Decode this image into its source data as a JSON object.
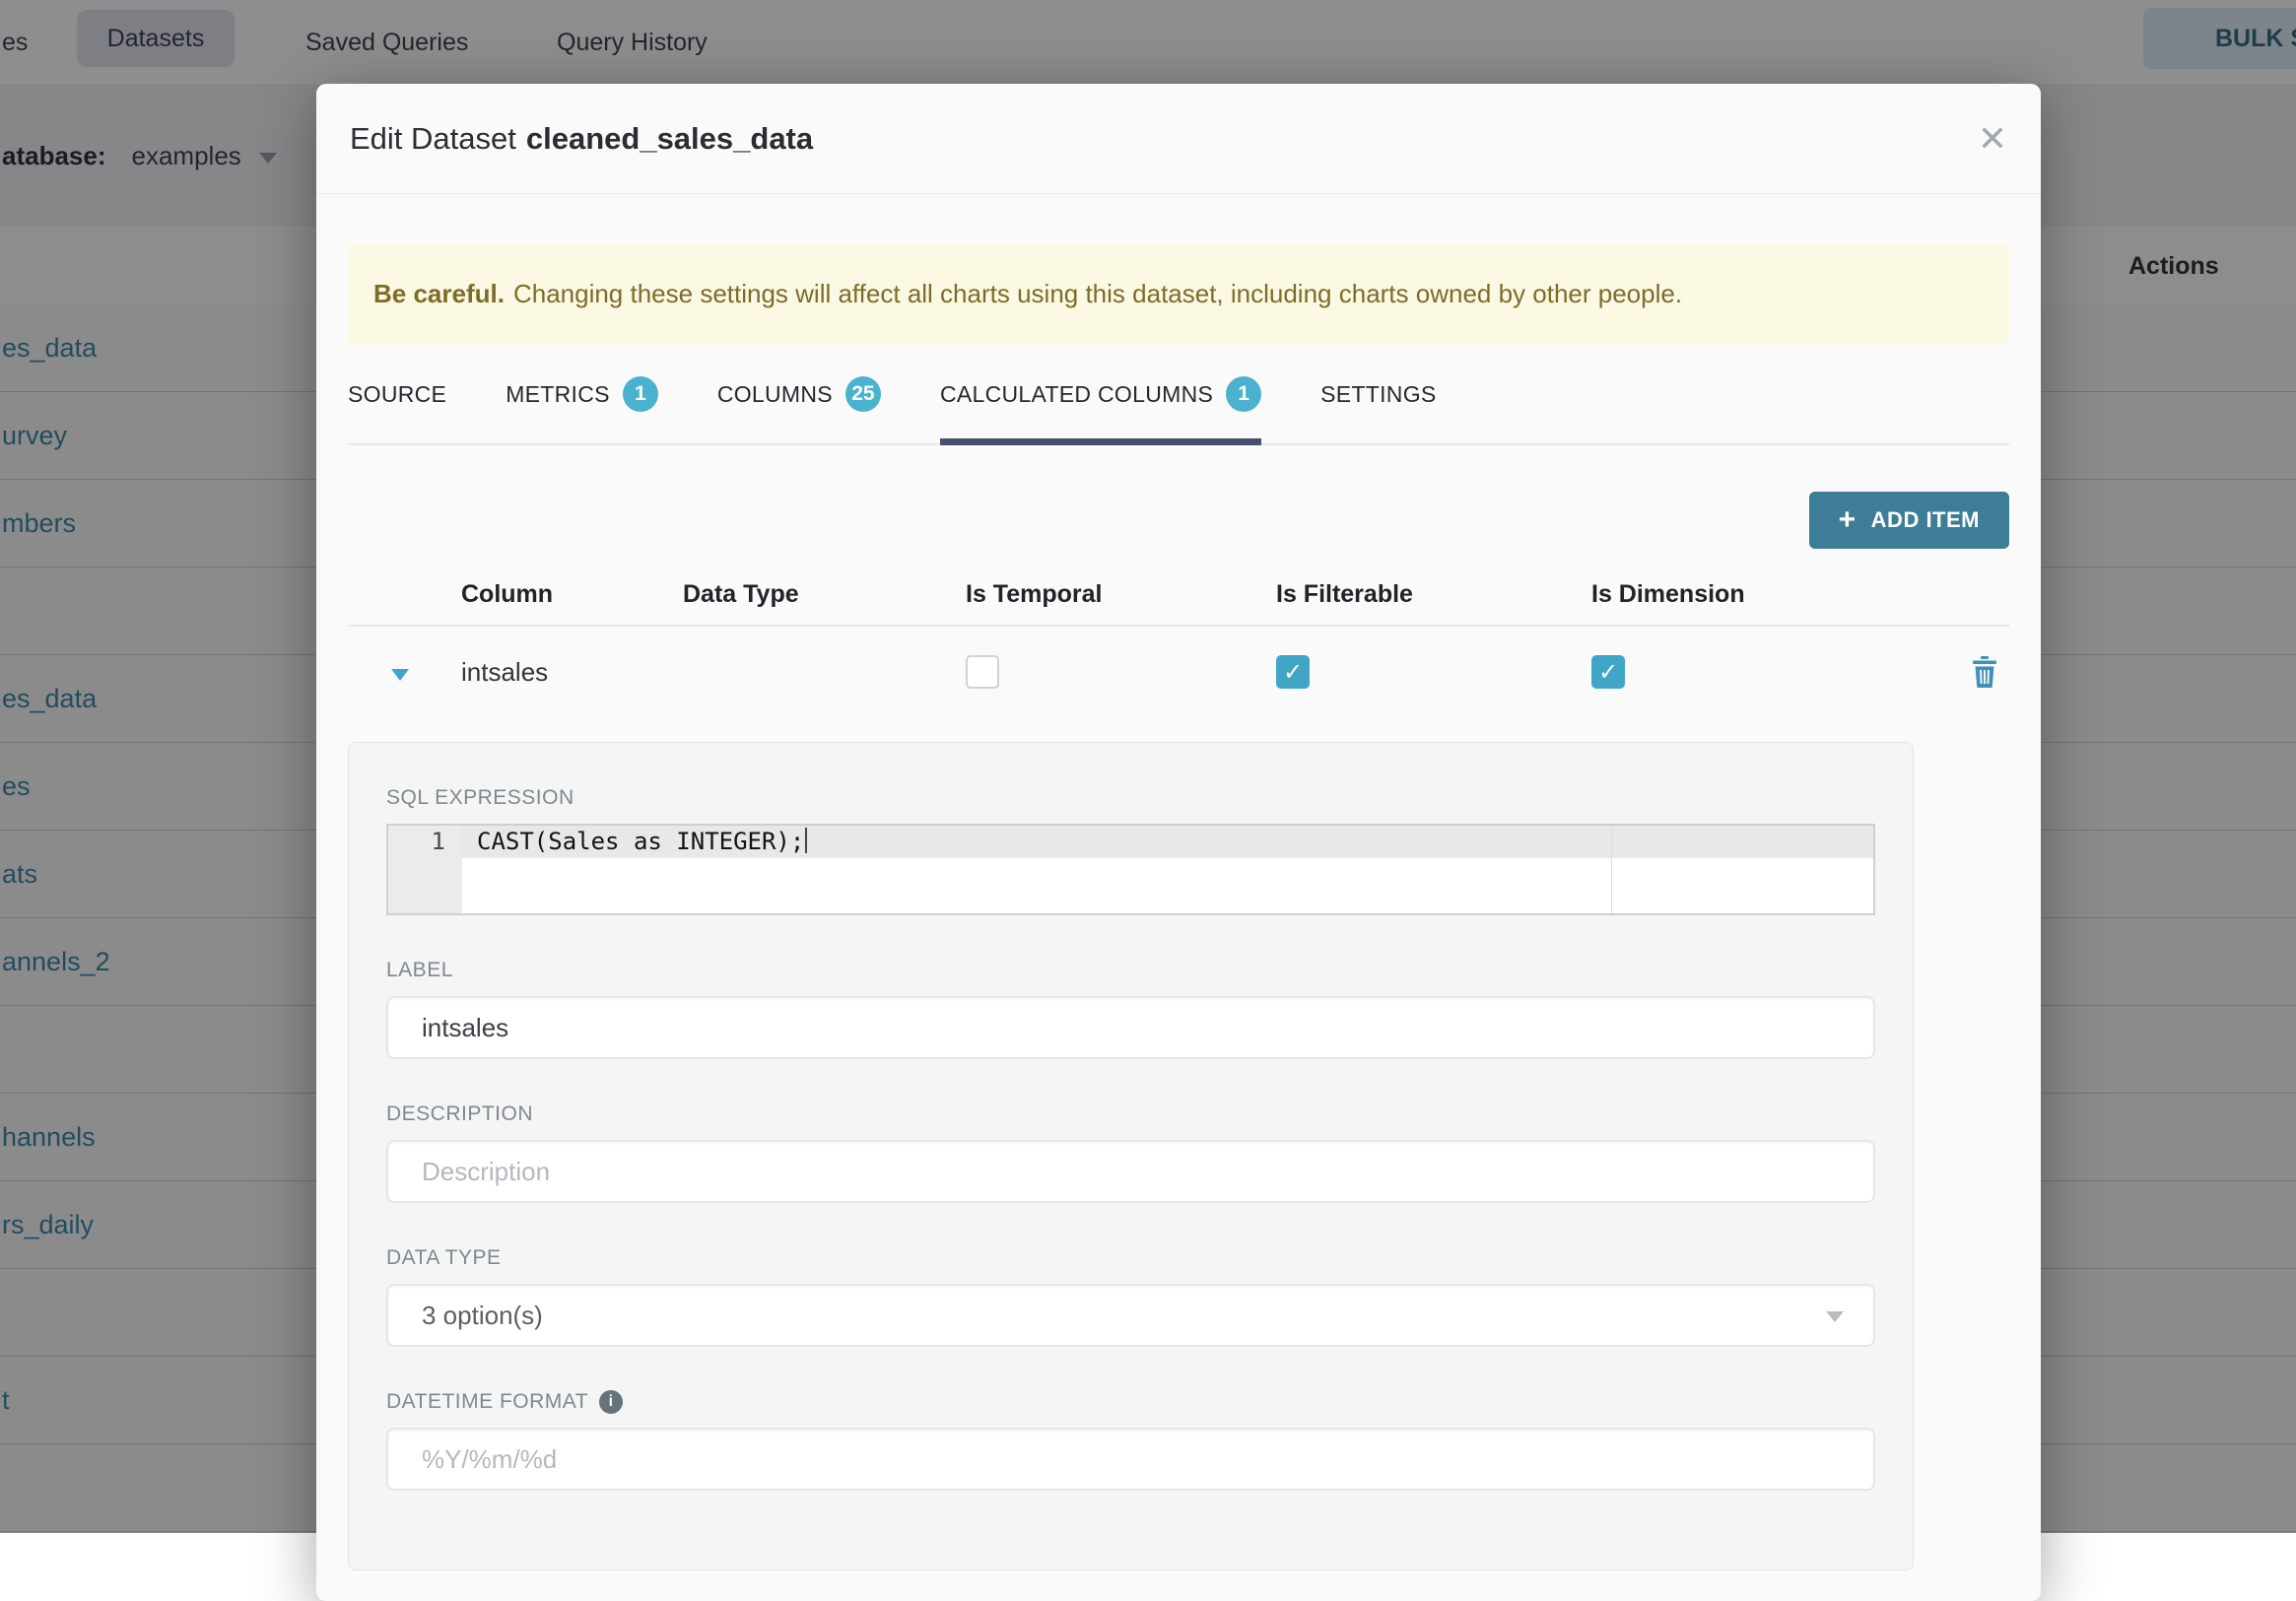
{
  "background": {
    "nav": {
      "tab_fragment": "es",
      "tabs": [
        "Datasets",
        "Saved Queries",
        "Query History"
      ],
      "bulk_select_label": "BULK SELE"
    },
    "filter": {
      "database_label": "atabase:",
      "database_value": "examples"
    },
    "table": {
      "actions_header": "Actions",
      "rows": [
        {
          "label": "es_data"
        },
        {
          "label": "urvey"
        },
        {
          "label": "mbers"
        },
        {
          "label": ""
        },
        {
          "label": "es_data"
        },
        {
          "label": "es"
        },
        {
          "label": "ats"
        },
        {
          "label": "annels_2"
        },
        {
          "label": ""
        },
        {
          "label": "hannels"
        },
        {
          "label": "rs_daily"
        },
        {
          "label": ""
        },
        {
          "label": "t"
        },
        {
          "label": ""
        }
      ]
    }
  },
  "modal": {
    "title_prefix": "Edit Dataset",
    "title_name": "cleaned_sales_data",
    "warning": {
      "bold": "Be careful.",
      "text": "Changing these settings will affect all charts using this dataset, including charts owned by other people."
    },
    "tabs": [
      {
        "label": "SOURCE"
      },
      {
        "label": "METRICS",
        "badge": "1"
      },
      {
        "label": "COLUMNS",
        "badge": "25"
      },
      {
        "label": "CALCULATED COLUMNS",
        "badge": "1",
        "active": true
      },
      {
        "label": "SETTINGS"
      }
    ],
    "add_item_label": "ADD ITEM",
    "columns_table": {
      "headers": [
        "Column",
        "Data Type",
        "Is Temporal",
        "Is Filterable",
        "Is Dimension"
      ],
      "row": {
        "column": "intsales",
        "is_temporal": false,
        "is_filterable": true,
        "is_dimension": true
      }
    },
    "detail": {
      "sql_label": "SQL EXPRESSION",
      "sql_line_number": "1",
      "sql_code": "CAST(Sales as INTEGER);",
      "label_label": "LABEL",
      "label_value": "intsales",
      "description_label": "DESCRIPTION",
      "description_placeholder": "Description",
      "data_type_label": "DATA TYPE",
      "data_type_value": "3 option(s)",
      "datetime_label": "DATETIME FORMAT",
      "datetime_placeholder": "%Y/%m/%d"
    },
    "icons": {
      "close": "✕",
      "plus": "+",
      "check": "✓",
      "info": "i"
    },
    "colors": {
      "accent_teal": "#41a6c6",
      "badge": "#4ab2cf",
      "add_item_button": "#3e7d96",
      "active_tab_underline": "#464f6e",
      "warning_bg": "#fbf8e4",
      "warning_text": "#7d6c28",
      "link": "#3e88a8"
    }
  }
}
